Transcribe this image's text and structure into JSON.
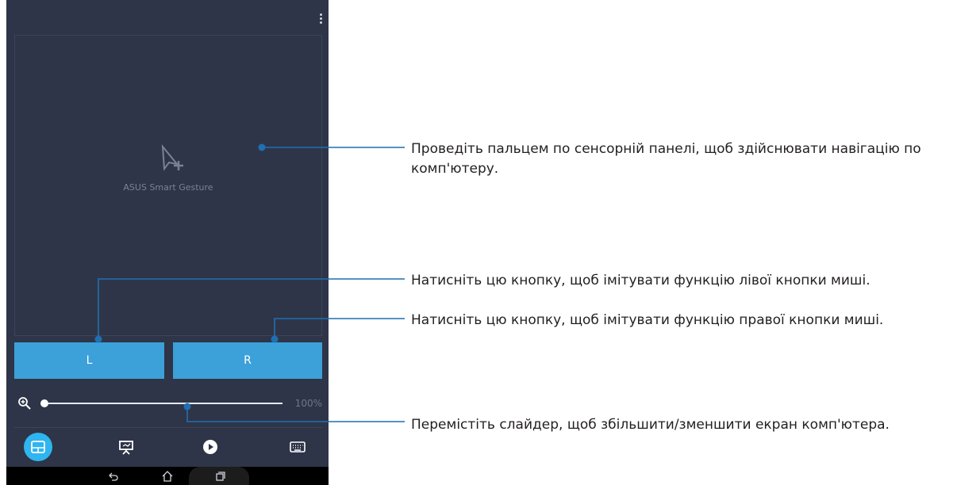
{
  "app": {
    "touchpad_label": "ASUS Smart Gesture",
    "left_button_label": "L",
    "right_button_label": "R",
    "zoom_value": "100%",
    "zoom_level_fraction": 0.0,
    "tabs": [
      {
        "name": "touchpad",
        "icon": "touchpad-icon",
        "active": true
      },
      {
        "name": "presentation",
        "icon": "presentation-icon",
        "active": false
      },
      {
        "name": "media",
        "icon": "play-icon",
        "active": false
      },
      {
        "name": "keyboard",
        "icon": "keyboard-icon",
        "active": false
      }
    ],
    "nav": [
      "back-icon",
      "home-icon",
      "recents-icon"
    ]
  },
  "callouts": {
    "touchpad": "Проведіть пальцем по сенсорній панелі, щоб здійснювати навігацію по комп'ютеру.",
    "left_button": "Натисніть цю кнопку, щоб імітувати функцію лівої кнопки миші.",
    "right_button": "Натисніть цю кнопку, щоб імітувати функцію правої кнопки миші.",
    "slider": "Перемістіть слайдер, щоб збільшити/зменшити екран комп'ютера."
  },
  "colors": {
    "screen_bg": "#2e3548",
    "button_blue": "#3ca0d9",
    "active_tab": "#2fb5ef",
    "callout_line": "#1f6fb2"
  }
}
